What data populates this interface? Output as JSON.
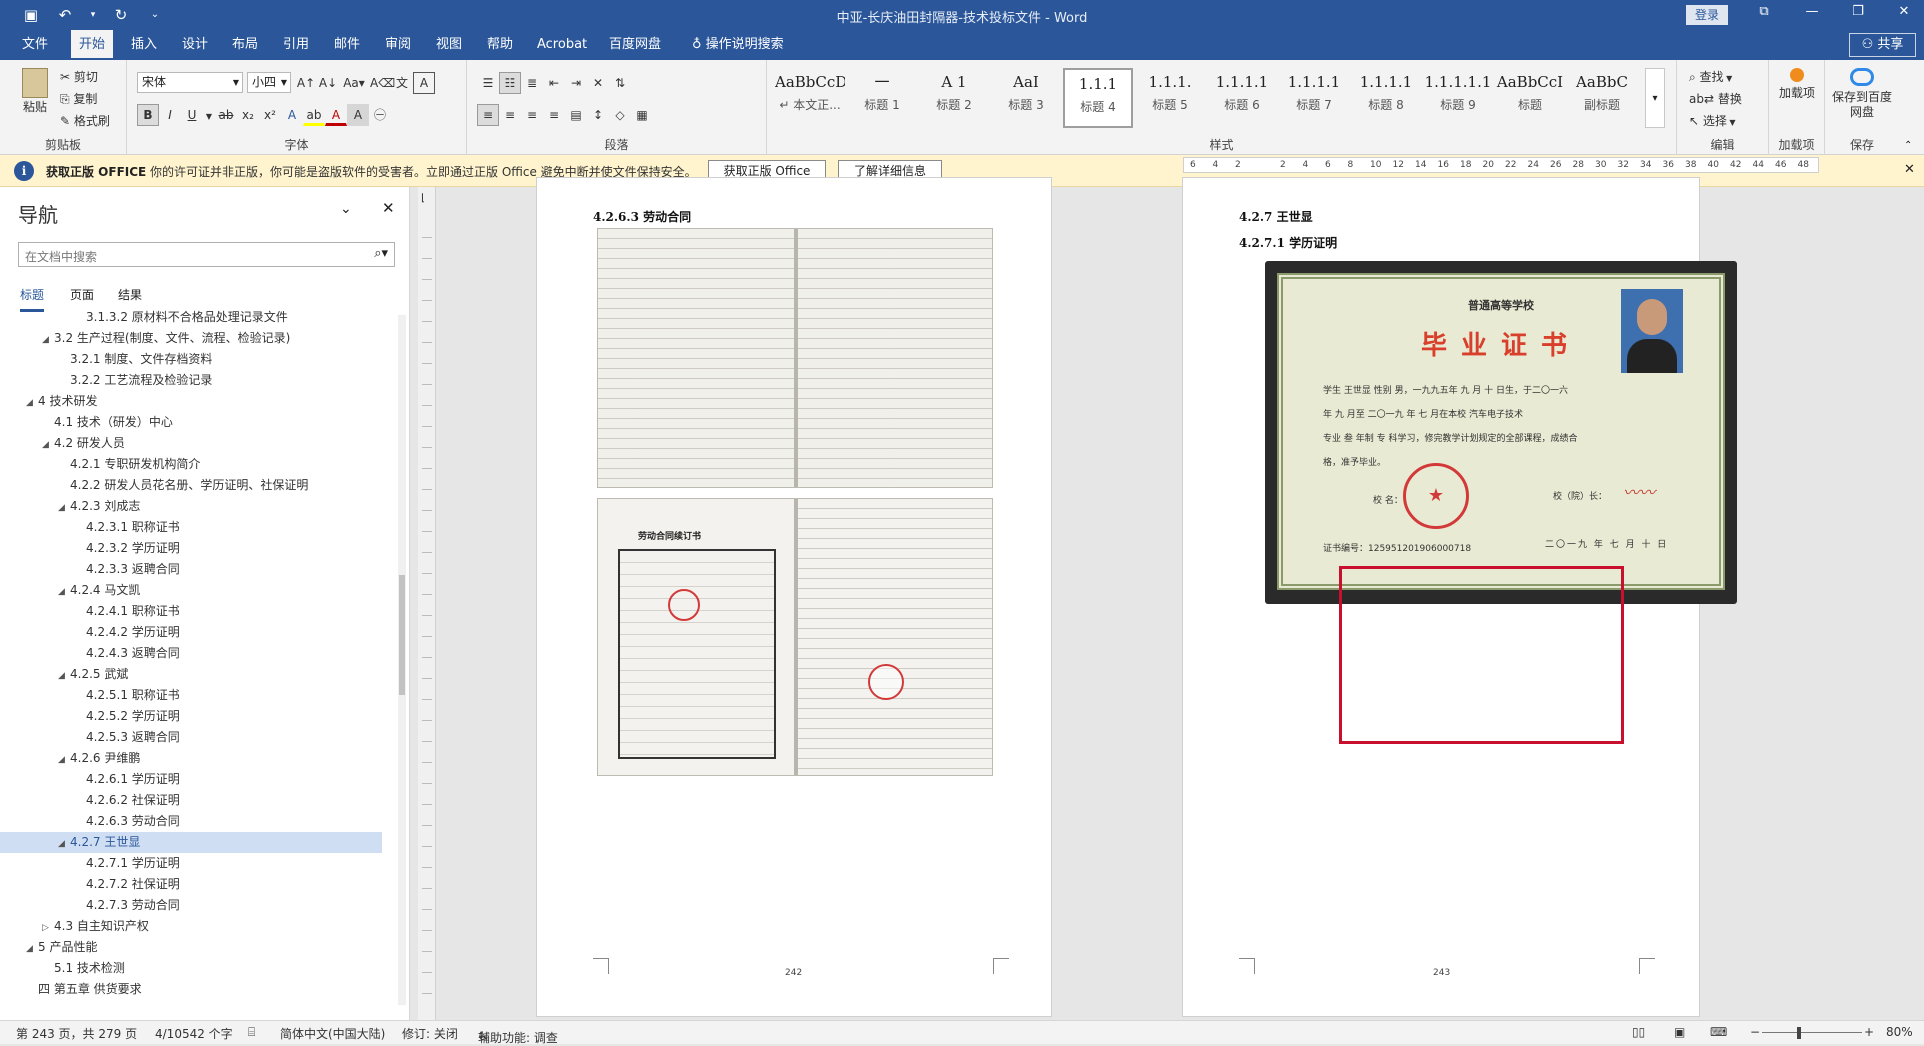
{
  "window": {
    "title": "中亚-长庆油田封隔器-技术投标文件 - Word",
    "login_label": "登录",
    "share_label": "共享"
  },
  "menu": {
    "tabs": [
      "文件",
      "开始",
      "插入",
      "设计",
      "布局",
      "引用",
      "邮件",
      "审阅",
      "视图",
      "帮助",
      "Acrobat",
      "百度网盘"
    ],
    "active_tab": "开始",
    "tell_me": "操作说明搜索"
  },
  "ribbon": {
    "clipboard": {
      "paste": "粘贴",
      "cut": "剪切",
      "copy": "复制",
      "format_painter": "格式刷",
      "label": "剪贴板"
    },
    "font": {
      "name": "宋体",
      "size": "小四",
      "label": "字体"
    },
    "paragraph": {
      "label": "段落"
    },
    "styles": {
      "label": "样式",
      "items": [
        {
          "preview": "AaBbCcDdI",
          "name": "↵ 本文正..."
        },
        {
          "preview": "一",
          "name": "标题 1"
        },
        {
          "preview": "A 1",
          "name": "标题 2"
        },
        {
          "preview": "AaI",
          "name": "标题 3"
        },
        {
          "preview": "1.1.1",
          "name": "标题 4"
        },
        {
          "preview": "1.1.1.",
          "name": "标题 5"
        },
        {
          "preview": "1.1.1.1",
          "name": "标题 6"
        },
        {
          "preview": "1.1.1.1",
          "name": "标题 7"
        },
        {
          "preview": "1.1.1.1",
          "name": "标题 8"
        },
        {
          "preview": "1.1.1.1.1",
          "name": "标题 9"
        },
        {
          "preview": "AaBbCcI",
          "name": "标题"
        },
        {
          "preview": "AaBbC",
          "name": "副标题"
        }
      ]
    },
    "editing": {
      "find": "查找",
      "replace": "替换",
      "select": "选择",
      "label": "编辑"
    },
    "addins": {
      "button": "加载项",
      "label": "加载项"
    },
    "save": {
      "button": "保存到百度网盘",
      "label": "保存"
    }
  },
  "notice": {
    "title": "获取正版 OFFICE",
    "message": "你的许可证并非正版，你可能是盗版软件的受害者。立即通过正版 Office 避免中断并使文件保持安全。",
    "btn_genuine": "获取正版 Office",
    "btn_learn": "了解详细信息"
  },
  "nav": {
    "title": "导航",
    "search_placeholder": "在文档中搜索",
    "tabs": [
      "标题",
      "页面",
      "结果"
    ],
    "items": [
      {
        "text": "3.1.3.2 原材料不合格品处理记录文件",
        "level": 3,
        "arrow": ""
      },
      {
        "text": "3.2 生产过程(制度、文件、流程、检验记录)",
        "level": 1,
        "arrow": "◢"
      },
      {
        "text": "3.2.1 制度、文件存档资料",
        "level": 2,
        "arrow": ""
      },
      {
        "text": "3.2.2 工艺流程及检验记录",
        "level": 2,
        "arrow": ""
      },
      {
        "text": "4 技术研发",
        "level": 0,
        "arrow": "◢"
      },
      {
        "text": "4.1 技术（研发）中心",
        "level": 1,
        "arrow": ""
      },
      {
        "text": "4.2 研发人员",
        "level": 1,
        "arrow": "◢"
      },
      {
        "text": "4.2.1 专职研发机构简介",
        "level": 2,
        "arrow": ""
      },
      {
        "text": "4.2.2 研发人员花名册、学历证明、社保证明",
        "level": 2,
        "arrow": ""
      },
      {
        "text": "4.2.3 刘成志",
        "level": 2,
        "arrow": "◢"
      },
      {
        "text": "4.2.3.1 职称证书",
        "level": 3,
        "arrow": ""
      },
      {
        "text": "4.2.3.2 学历证明",
        "level": 3,
        "arrow": ""
      },
      {
        "text": "4.2.3.3 返聘合同",
        "level": 3,
        "arrow": ""
      },
      {
        "text": "4.2.4 马文凯",
        "level": 2,
        "arrow": "◢"
      },
      {
        "text": "4.2.4.1 职称证书",
        "level": 3,
        "arrow": ""
      },
      {
        "text": "4.2.4.2 学历证明",
        "level": 3,
        "arrow": ""
      },
      {
        "text": "4.2.4.3 返聘合同",
        "level": 3,
        "arrow": ""
      },
      {
        "text": "4.2.5 武斌",
        "level": 2,
        "arrow": "◢"
      },
      {
        "text": "4.2.5.1 职称证书",
        "level": 3,
        "arrow": ""
      },
      {
        "text": "4.2.5.2 学历证明",
        "level": 3,
        "arrow": ""
      },
      {
        "text": "4.2.5.3 返聘合同",
        "level": 3,
        "arrow": ""
      },
      {
        "text": "4.2.6 尹维鹏",
        "level": 2,
        "arrow": "◢"
      },
      {
        "text": "4.2.6.1 学历证明",
        "level": 3,
        "arrow": ""
      },
      {
        "text": "4.2.6.2 社保证明",
        "level": 3,
        "arrow": ""
      },
      {
        "text": "4.2.6.3 劳动合同",
        "level": 3,
        "arrow": ""
      },
      {
        "text": "4.2.7 王世显",
        "level": 2,
        "arrow": "◢",
        "selected": true
      },
      {
        "text": "4.2.7.1 学历证明",
        "level": 3,
        "arrow": ""
      },
      {
        "text": "4.2.7.2 社保证明",
        "level": 3,
        "arrow": ""
      },
      {
        "text": "4.2.7.3 劳动合同",
        "level": 3,
        "arrow": ""
      },
      {
        "text": "4.3 自主知识产权",
        "level": 1,
        "arrow": "▷"
      },
      {
        "text": "5 产品性能",
        "level": 0,
        "arrow": "◢"
      },
      {
        "text": "5.1 技术检测",
        "level": 1,
        "arrow": ""
      },
      {
        "text": "四 第五章 供货要求",
        "level": 0,
        "arrow": ""
      }
    ]
  },
  "ruler": {
    "ticks": [
      "6",
      "4",
      "2",
      "",
      "2",
      "4",
      "6",
      "8",
      "10",
      "12",
      "14",
      "16",
      "18",
      "20",
      "22",
      "24",
      "26",
      "28",
      "30",
      "32",
      "34",
      "36",
      "38",
      "40",
      "42",
      "44",
      "46",
      "48"
    ]
  },
  "page_left": {
    "heading": "4.2.6.3  劳动合同",
    "page_number": "242"
  },
  "page_right": {
    "heading1": "4.2.7  王世显",
    "heading2": "4.2.7.1  学历证明",
    "page_number": "243",
    "certificate": {
      "school_type": "普通高等学校",
      "title": "毕业证书",
      "line1": "学生  王世显   性别  男，一九九五年 九 月 十 日生，于二〇一六",
      "line2": "年 九 月至 二〇一九 年 七 月在本校        汽车电子技术",
      "line3": "专业    叁 年制  专  科学习，修完教学计划规定的全部课程，成绩合",
      "line4": "格，准予毕业。",
      "sign": "校（院）长：",
      "school": "校   名：",
      "cert_no": "证书编号：125951201906000718",
      "date": "二〇一九 年 七 月 十 日"
    }
  },
  "contract": {
    "renewal_title": "劳动合同续订书"
  },
  "status": {
    "page": "第 243 页，共 279 页",
    "words": "4/10542 个字",
    "lang": "简体中文(中国大陆)",
    "track": "修订: 关闭",
    "access": "辅助功能: 调查",
    "zoom": "80%"
  },
  "colors": {
    "accent": "#2b579a",
    "notice_bg": "#fff4ce",
    "highlight_box": "#c8102e"
  }
}
